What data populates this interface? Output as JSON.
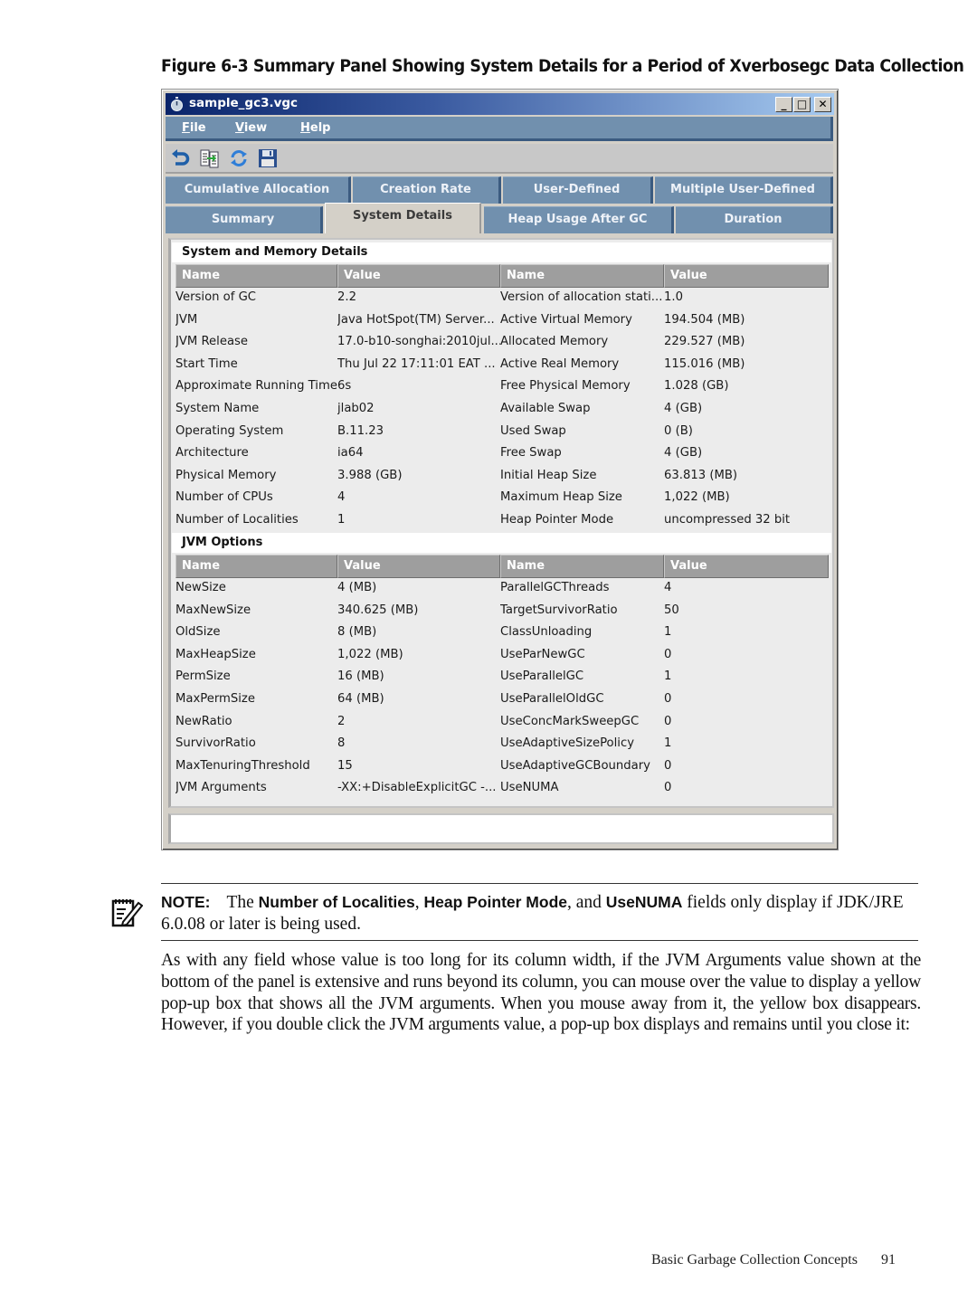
{
  "figure_caption": "Figure 6-3 Summary Panel Showing System Details for a Period of Xverbosegc Data Collection",
  "window": {
    "title": "sample_gc3.vgc",
    "controls": {
      "minimize": "_",
      "maximize": "□",
      "close": "✕"
    },
    "menu": [
      {
        "mnemonic": "F",
        "rest": "ile"
      },
      {
        "mnemonic": "V",
        "rest": "iew"
      },
      {
        "mnemonic": "H",
        "rest": "elp"
      }
    ],
    "toolbar": [
      "undo-icon",
      "compare-files-icon",
      "refresh-icon",
      "save-icon"
    ],
    "tabs_row1": [
      "Cumulative Allocation",
      "Creation Rate",
      "User-Defined",
      "Multiple User-Defined"
    ],
    "tabs_row2": [
      "Summary",
      "System Details",
      "Heap Usage After GC",
      "Duration"
    ],
    "active_tab": "System Details"
  },
  "system_details": {
    "title": "System and Memory Details",
    "headers": [
      "Name",
      "Value",
      "Name",
      "Value"
    ],
    "rows": [
      [
        "Version of GC",
        "2.2",
        "Version of allocation stati...",
        "1.0"
      ],
      [
        "JVM",
        "Java HotSpot(TM) Server...",
        "Active Virtual Memory",
        "194.504 (MB)"
      ],
      [
        "JVM Release",
        "17.0-b10-songhai:2010jul...",
        "Allocated Memory",
        "229.527 (MB)"
      ],
      [
        "Start Time",
        "Thu Jul 22 17:11:01 EAT ...",
        "Active Real Memory",
        "115.016 (MB)"
      ],
      [
        "Approximate Running Time",
        "6s",
        "Free Physical Memory",
        "1.028 (GB)"
      ],
      [
        "System Name",
        "jlab02",
        "Available Swap",
        "4 (GB)"
      ],
      [
        "Operating System",
        "B.11.23",
        "Used Swap",
        "0 (B)"
      ],
      [
        "Architecture",
        "ia64",
        "Free Swap",
        "4 (GB)"
      ],
      [
        "Physical Memory",
        "3.988 (GB)",
        "Initial Heap Size",
        "63.813 (MB)"
      ],
      [
        "Number of CPUs",
        "4",
        "Maximum Heap Size",
        "1,022 (MB)"
      ],
      [
        "Number of Localities",
        "1",
        "Heap Pointer Mode",
        "uncompressed 32 bit"
      ]
    ]
  },
  "jvm_options": {
    "title": "JVM Options",
    "headers": [
      "Name",
      "Value",
      "Name",
      "Value"
    ],
    "rows": [
      [
        "NewSize",
        "4 (MB)",
        "ParallelGCThreads",
        "4"
      ],
      [
        "MaxNewSize",
        "340.625 (MB)",
        "TargetSurvivorRatio",
        "50"
      ],
      [
        "OldSize",
        "8 (MB)",
        "ClassUnloading",
        "1"
      ],
      [
        "MaxHeapSize",
        "1,022 (MB)",
        "UseParNewGC",
        "0"
      ],
      [
        "PermSize",
        "16 (MB)",
        "UseParallelGC",
        "1"
      ],
      [
        "MaxPermSize",
        "64 (MB)",
        "UseParallelOldGC",
        "0"
      ],
      [
        "NewRatio",
        "2",
        "UseConcMarkSweepGC",
        "0"
      ],
      [
        "SurvivorRatio",
        "8",
        "UseAdaptiveSizePolicy",
        "1"
      ],
      [
        "MaxTenuringThreshold",
        "15",
        "UseAdaptiveGCBoundary",
        "0"
      ],
      [
        "JVM Arguments",
        "-XX:+DisableExplicitGC -...",
        "UseNUMA",
        "0"
      ]
    ]
  },
  "note": {
    "label": "NOTE:",
    "text_before": "The ",
    "bold1": "Number of Localities",
    "sep1": ", ",
    "bold2": "Heap Pointer Mode",
    "sep2": ", and ",
    "bold3": "UseNUMA",
    "text_after": " fields only display if JDK/JRE 6.0.08 or later is being used."
  },
  "body_paragraph": "As with any field whose value is too long for its column width, if the JVM Arguments value shown at the bottom of the panel is extensive and runs beyond its column, you can mouse over the value to display a yellow pop-up box that shows all the JVM arguments. When you mouse away from it, the yellow box disappears. However, if you double click the JVM arguments value, a pop-up box displays and remains until you close it:",
  "footer": {
    "section": "Basic Garbage Collection Concepts",
    "page": "91"
  }
}
